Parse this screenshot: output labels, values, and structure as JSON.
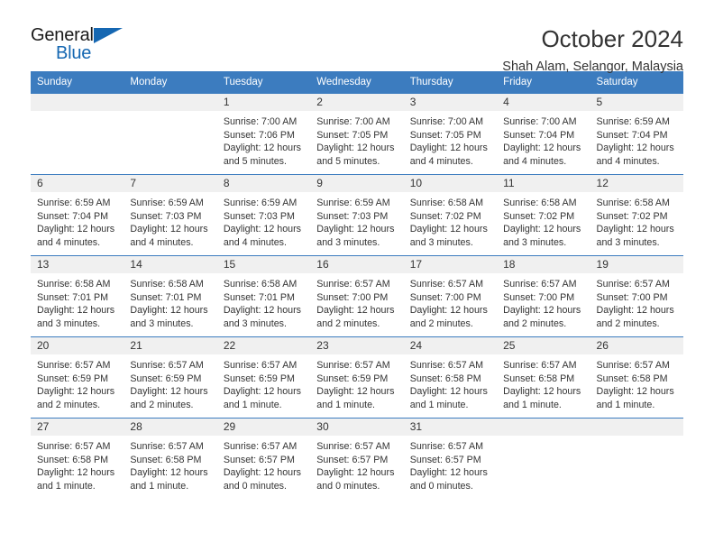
{
  "brand": {
    "name_part1": "General",
    "name_part2": "Blue",
    "triangle_color": "#1567b2"
  },
  "header": {
    "title": "October 2024",
    "subtitle": "Shah Alam, Selangor, Malaysia"
  },
  "calendar": {
    "header_bg": "#3c7cbf",
    "daynum_bg": "#f0f0f0",
    "weekdays": [
      "Sunday",
      "Monday",
      "Tuesday",
      "Wednesday",
      "Thursday",
      "Friday",
      "Saturday"
    ],
    "weeks": [
      [
        {
          "day": "",
          "empty": true
        },
        {
          "day": "",
          "empty": true
        },
        {
          "day": "1",
          "sunrise": "Sunrise: 7:00 AM",
          "sunset": "Sunset: 7:06 PM",
          "daylight_line1": "Daylight: 12 hours",
          "daylight_line2": "and 5 minutes."
        },
        {
          "day": "2",
          "sunrise": "Sunrise: 7:00 AM",
          "sunset": "Sunset: 7:05 PM",
          "daylight_line1": "Daylight: 12 hours",
          "daylight_line2": "and 5 minutes."
        },
        {
          "day": "3",
          "sunrise": "Sunrise: 7:00 AM",
          "sunset": "Sunset: 7:05 PM",
          "daylight_line1": "Daylight: 12 hours",
          "daylight_line2": "and 4 minutes."
        },
        {
          "day": "4",
          "sunrise": "Sunrise: 7:00 AM",
          "sunset": "Sunset: 7:04 PM",
          "daylight_line1": "Daylight: 12 hours",
          "daylight_line2": "and 4 minutes."
        },
        {
          "day": "5",
          "sunrise": "Sunrise: 6:59 AM",
          "sunset": "Sunset: 7:04 PM",
          "daylight_line1": "Daylight: 12 hours",
          "daylight_line2": "and 4 minutes."
        }
      ],
      [
        {
          "day": "6",
          "sunrise": "Sunrise: 6:59 AM",
          "sunset": "Sunset: 7:04 PM",
          "daylight_line1": "Daylight: 12 hours",
          "daylight_line2": "and 4 minutes."
        },
        {
          "day": "7",
          "sunrise": "Sunrise: 6:59 AM",
          "sunset": "Sunset: 7:03 PM",
          "daylight_line1": "Daylight: 12 hours",
          "daylight_line2": "and 4 minutes."
        },
        {
          "day": "8",
          "sunrise": "Sunrise: 6:59 AM",
          "sunset": "Sunset: 7:03 PM",
          "daylight_line1": "Daylight: 12 hours",
          "daylight_line2": "and 4 minutes."
        },
        {
          "day": "9",
          "sunrise": "Sunrise: 6:59 AM",
          "sunset": "Sunset: 7:03 PM",
          "daylight_line1": "Daylight: 12 hours",
          "daylight_line2": "and 3 minutes."
        },
        {
          "day": "10",
          "sunrise": "Sunrise: 6:58 AM",
          "sunset": "Sunset: 7:02 PM",
          "daylight_line1": "Daylight: 12 hours",
          "daylight_line2": "and 3 minutes."
        },
        {
          "day": "11",
          "sunrise": "Sunrise: 6:58 AM",
          "sunset": "Sunset: 7:02 PM",
          "daylight_line1": "Daylight: 12 hours",
          "daylight_line2": "and 3 minutes."
        },
        {
          "day": "12",
          "sunrise": "Sunrise: 6:58 AM",
          "sunset": "Sunset: 7:02 PM",
          "daylight_line1": "Daylight: 12 hours",
          "daylight_line2": "and 3 minutes."
        }
      ],
      [
        {
          "day": "13",
          "sunrise": "Sunrise: 6:58 AM",
          "sunset": "Sunset: 7:01 PM",
          "daylight_line1": "Daylight: 12 hours",
          "daylight_line2": "and 3 minutes."
        },
        {
          "day": "14",
          "sunrise": "Sunrise: 6:58 AM",
          "sunset": "Sunset: 7:01 PM",
          "daylight_line1": "Daylight: 12 hours",
          "daylight_line2": "and 3 minutes."
        },
        {
          "day": "15",
          "sunrise": "Sunrise: 6:58 AM",
          "sunset": "Sunset: 7:01 PM",
          "daylight_line1": "Daylight: 12 hours",
          "daylight_line2": "and 3 minutes."
        },
        {
          "day": "16",
          "sunrise": "Sunrise: 6:57 AM",
          "sunset": "Sunset: 7:00 PM",
          "daylight_line1": "Daylight: 12 hours",
          "daylight_line2": "and 2 minutes."
        },
        {
          "day": "17",
          "sunrise": "Sunrise: 6:57 AM",
          "sunset": "Sunset: 7:00 PM",
          "daylight_line1": "Daylight: 12 hours",
          "daylight_line2": "and 2 minutes."
        },
        {
          "day": "18",
          "sunrise": "Sunrise: 6:57 AM",
          "sunset": "Sunset: 7:00 PM",
          "daylight_line1": "Daylight: 12 hours",
          "daylight_line2": "and 2 minutes."
        },
        {
          "day": "19",
          "sunrise": "Sunrise: 6:57 AM",
          "sunset": "Sunset: 7:00 PM",
          "daylight_line1": "Daylight: 12 hours",
          "daylight_line2": "and 2 minutes."
        }
      ],
      [
        {
          "day": "20",
          "sunrise": "Sunrise: 6:57 AM",
          "sunset": "Sunset: 6:59 PM",
          "daylight_line1": "Daylight: 12 hours",
          "daylight_line2": "and 2 minutes."
        },
        {
          "day": "21",
          "sunrise": "Sunrise: 6:57 AM",
          "sunset": "Sunset: 6:59 PM",
          "daylight_line1": "Daylight: 12 hours",
          "daylight_line2": "and 2 minutes."
        },
        {
          "day": "22",
          "sunrise": "Sunrise: 6:57 AM",
          "sunset": "Sunset: 6:59 PM",
          "daylight_line1": "Daylight: 12 hours",
          "daylight_line2": "and 1 minute."
        },
        {
          "day": "23",
          "sunrise": "Sunrise: 6:57 AM",
          "sunset": "Sunset: 6:59 PM",
          "daylight_line1": "Daylight: 12 hours",
          "daylight_line2": "and 1 minute."
        },
        {
          "day": "24",
          "sunrise": "Sunrise: 6:57 AM",
          "sunset": "Sunset: 6:58 PM",
          "daylight_line1": "Daylight: 12 hours",
          "daylight_line2": "and 1 minute."
        },
        {
          "day": "25",
          "sunrise": "Sunrise: 6:57 AM",
          "sunset": "Sunset: 6:58 PM",
          "daylight_line1": "Daylight: 12 hours",
          "daylight_line2": "and 1 minute."
        },
        {
          "day": "26",
          "sunrise": "Sunrise: 6:57 AM",
          "sunset": "Sunset: 6:58 PM",
          "daylight_line1": "Daylight: 12 hours",
          "daylight_line2": "and 1 minute."
        }
      ],
      [
        {
          "day": "27",
          "sunrise": "Sunrise: 6:57 AM",
          "sunset": "Sunset: 6:58 PM",
          "daylight_line1": "Daylight: 12 hours",
          "daylight_line2": "and 1 minute."
        },
        {
          "day": "28",
          "sunrise": "Sunrise: 6:57 AM",
          "sunset": "Sunset: 6:58 PM",
          "daylight_line1": "Daylight: 12 hours",
          "daylight_line2": "and 1 minute."
        },
        {
          "day": "29",
          "sunrise": "Sunrise: 6:57 AM",
          "sunset": "Sunset: 6:57 PM",
          "daylight_line1": "Daylight: 12 hours",
          "daylight_line2": "and 0 minutes."
        },
        {
          "day": "30",
          "sunrise": "Sunrise: 6:57 AM",
          "sunset": "Sunset: 6:57 PM",
          "daylight_line1": "Daylight: 12 hours",
          "daylight_line2": "and 0 minutes."
        },
        {
          "day": "31",
          "sunrise": "Sunrise: 6:57 AM",
          "sunset": "Sunset: 6:57 PM",
          "daylight_line1": "Daylight: 12 hours",
          "daylight_line2": "and 0 minutes."
        },
        {
          "day": "",
          "empty": true
        },
        {
          "day": "",
          "empty": true
        }
      ]
    ]
  }
}
